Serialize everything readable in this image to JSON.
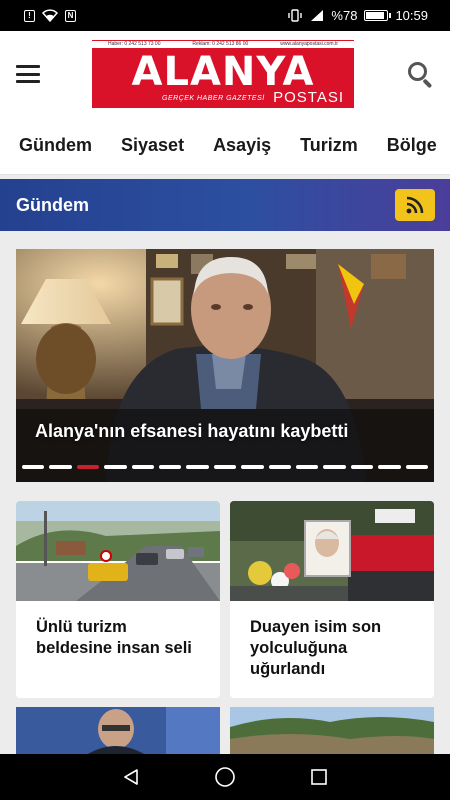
{
  "status_bar": {
    "battery": "%78",
    "time": "10:59"
  },
  "header": {
    "logo": {
      "title": "ALANYA",
      "brand": "POSTASI",
      "tagline": "GERÇEK HABER GAZETESİ",
      "contact_1": "Haber: 0 242 513 73 00",
      "contact_2": "Reklam: 0 242 513 86 00",
      "website": "www.alanyapostasi.com.tr"
    }
  },
  "categories": [
    "Gündem",
    "Siyaset",
    "Asayiş",
    "Turizm",
    "Bölge"
  ],
  "section": {
    "title": "Gündem"
  },
  "featured": {
    "title": "Alanya'nın efsanesi hayatını kaybetti",
    "dot_count": 15,
    "active_dot": 2
  },
  "cards": [
    {
      "title": "Ünlü turizm beldesine insan seli"
    },
    {
      "title": "Duayen isim son yolculuğuna uğurlandı"
    }
  ],
  "colors": {
    "brand_red": "#d9122a",
    "section_blue": "#24418f",
    "rss_yellow": "#f2c31b",
    "active_dot": "#c8202f"
  }
}
